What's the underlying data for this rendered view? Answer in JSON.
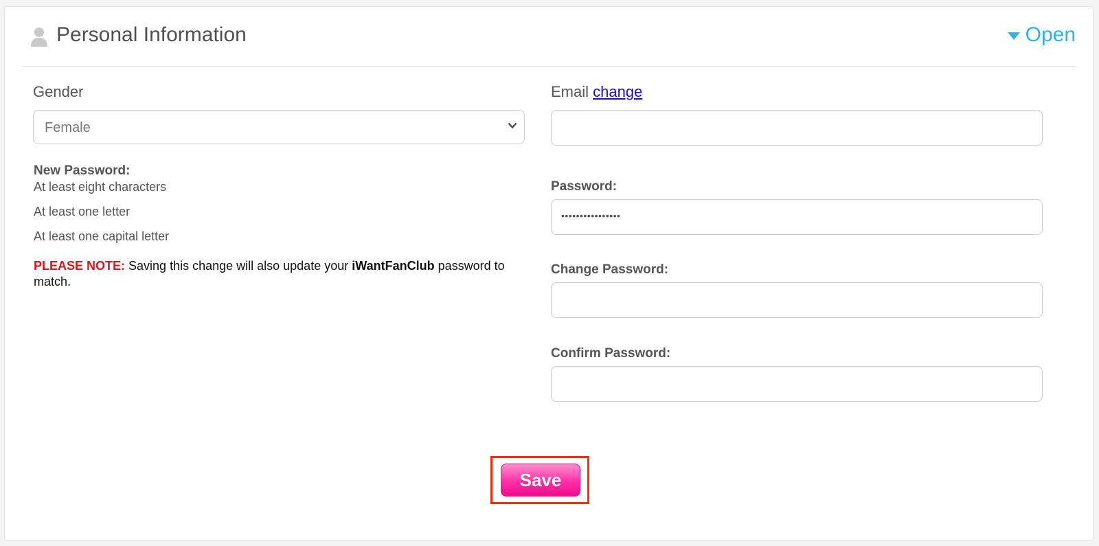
{
  "header": {
    "title": "Personal Information",
    "toggle_label": "Open"
  },
  "gender": {
    "label": "Gender",
    "selected": "Female"
  },
  "email": {
    "label": "Email",
    "change_link": "change",
    "value": ""
  },
  "password": {
    "label": "Password:",
    "masked_value": "••••••••••••••••"
  },
  "change_password": {
    "label": "Change Password:",
    "value": ""
  },
  "confirm_password": {
    "label": "Confirm Password:",
    "value": ""
  },
  "requirements": {
    "title": "New Password:",
    "rules": [
      "At least eight characters",
      "At least one letter",
      "At least one capital letter"
    ],
    "note_prefix": "PLEASE NOTE:",
    "note_text_1": "Saving this change will also update your",
    "note_brand": "iWantFanClub",
    "note_text_2": "password to match."
  },
  "save_label": "Save",
  "colors": {
    "accent": "#2fb3e8",
    "warning": "#e0131d",
    "save_button": "#ff2ea6",
    "highlight_frame": "#ff2a0a",
    "link": "#1a0dcc"
  }
}
